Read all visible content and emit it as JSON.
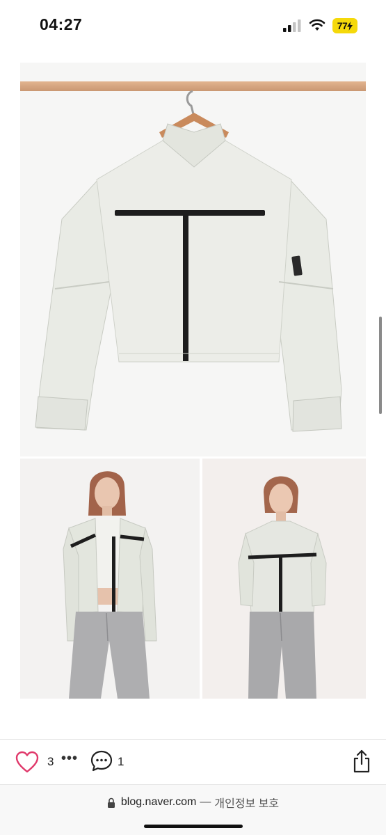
{
  "status_bar": {
    "time": "04:27",
    "battery": "77"
  },
  "post": {
    "likes": "3",
    "more_label": "•••",
    "comments": "1"
  },
  "browser": {
    "domain": "blog.naver.com",
    "separator": "—",
    "privacy_label": "개인정보 보호"
  },
  "colors": {
    "like_heart": "#e0396b",
    "battery": "#f5d90a"
  }
}
